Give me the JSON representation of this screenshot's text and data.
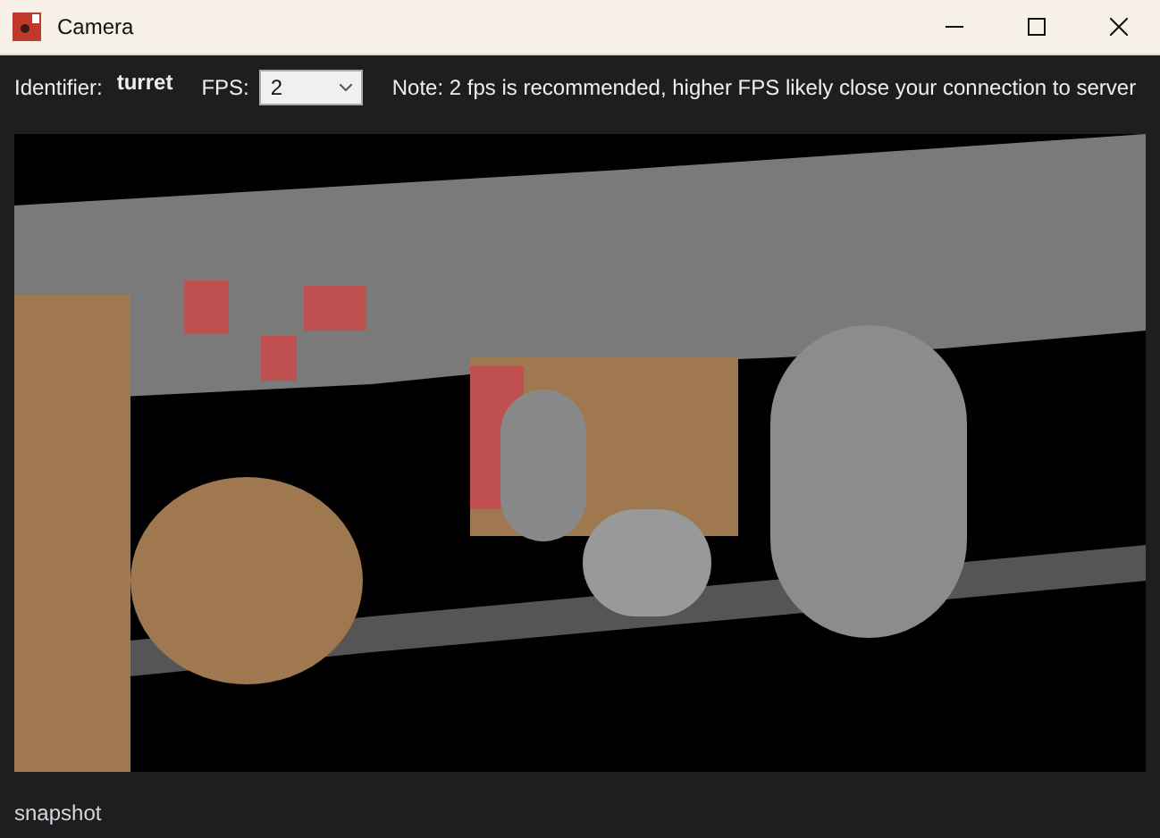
{
  "window": {
    "title": "Camera"
  },
  "toolbar": {
    "identifier_label": "Identifier:",
    "identifier_value": "turret",
    "fps_label": "FPS:",
    "fps_value": "2",
    "note": "Note: 2 fps is recommended, higher FPS likely close your connection to server"
  },
  "status_bar": {
    "text": "snapshot"
  }
}
